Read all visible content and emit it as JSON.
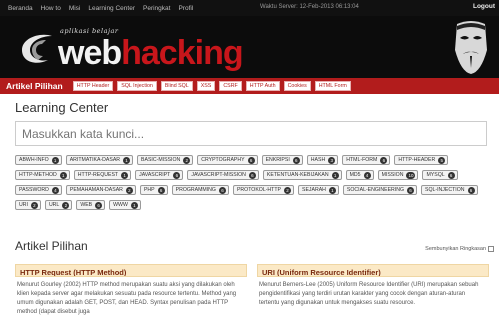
{
  "topbar": {
    "nav": [
      "Beranda",
      "How to",
      "Misi",
      "Learning Center",
      "Peringkat",
      "Profil"
    ],
    "server_time": "Waktu Server: 12-Feb-2013 06:13:04",
    "logout": "Logout"
  },
  "brand": {
    "tagline": "aplikasi belajar",
    "word1": "web",
    "word2": "hacking"
  },
  "rednav": {
    "title": "Artikel Pilihan",
    "links": [
      "HTTP Header",
      "SQL Injection",
      "Blind SQL",
      "XSS",
      "CSRF",
      "HTTP Auth",
      "Cookies",
      "HTML Form"
    ]
  },
  "learning_center": {
    "title": "Learning Center",
    "search_placeholder": "Masukkan kata kunci...",
    "tags": [
      {
        "label": "ABWH-INFO",
        "count": "1"
      },
      {
        "label": "ARITMATIKA-DASAR",
        "count": "1"
      },
      {
        "label": "BASIC-MISSION",
        "count": "2"
      },
      {
        "label": "CRYPTOGRAPHY",
        "count": "6"
      },
      {
        "label": "ENKRIPSI",
        "count": "6"
      },
      {
        "label": "HASH",
        "count": "3"
      },
      {
        "label": "HTML-FORM",
        "count": "6"
      },
      {
        "label": "HTTP-HEADER",
        "count": "5"
      },
      {
        "label": "HTTP-METHOD",
        "count": "1"
      },
      {
        "label": "HTTP-REQUEST",
        "count": "1"
      },
      {
        "label": "JAVASCRIPT",
        "count": "6"
      },
      {
        "label": "JAVASCRIPT-MISSION",
        "count": "6"
      },
      {
        "label": "KETENTUAN-KEBIJAKAN",
        "count": "1"
      },
      {
        "label": "MD5",
        "count": "4"
      },
      {
        "label": "MISSION",
        "count": "10"
      },
      {
        "label": "MYSQL",
        "count": "6"
      },
      {
        "label": "PASSWORD",
        "count": "4"
      },
      {
        "label": "PEMAHAMAN-DASAR",
        "count": "2"
      },
      {
        "label": "PHP",
        "count": "6"
      },
      {
        "label": "PROGRAMMING",
        "count": "6"
      },
      {
        "label": "PROTOKOL-HTTP",
        "count": "2"
      },
      {
        "label": "SEJARAH",
        "count": "1"
      },
      {
        "label": "SOCIAL-ENGINEERING",
        "count": "6"
      },
      {
        "label": "SQL-INJECTION",
        "count": "6"
      },
      {
        "label": "URI",
        "count": "2"
      },
      {
        "label": "URL",
        "count": "2"
      },
      {
        "label": "WEB",
        "count": "6"
      },
      {
        "label": "WWW",
        "count": "1"
      }
    ]
  },
  "artikel": {
    "title": "Artikel Pilihan",
    "hide_label": "Sembunyikan Ringkasan",
    "cards": [
      {
        "title": "HTTP Request (HTTP Method)",
        "summary": "Menurut Gourley (2002) HTTP method merupakan suatu aksi yang dilakukan oleh klien kepada server agar melakukan sesuatu pada resource tertentu. Method yang umum digunakan adalah GET, POST, dan HEAD. Syntax penulisan pada HTTP method (dapat disebut juga"
      },
      {
        "title": "URI (Uniform Resource Identifier)",
        "summary": "Menurut Berners-Lee (2005) Uniform Resource Identifier (URI) merupakan sebuah pengidentifikasi yang terdiri urutan karakter yang cocok dengan aturan-aturan tertentu yang digunakan untuk mengakses suatu resource."
      }
    ]
  }
}
